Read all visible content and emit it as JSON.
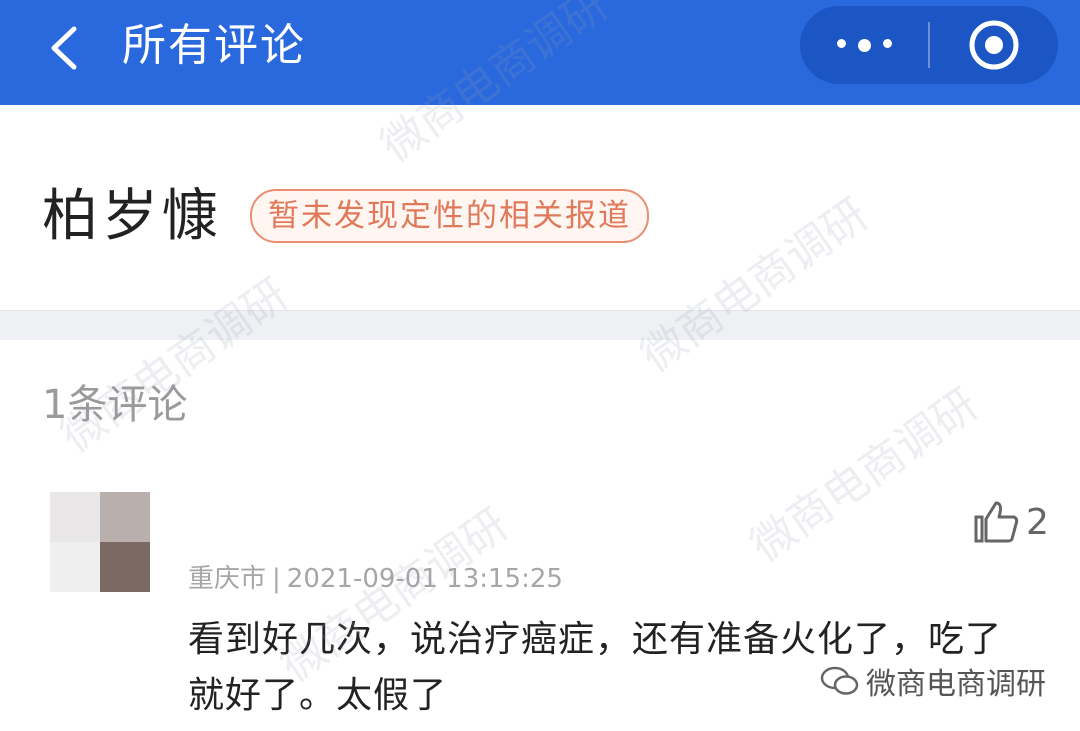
{
  "header": {
    "title": "所有评论",
    "back_icon": "chevron-left-icon",
    "more_icon": "more-dots-icon",
    "close_icon": "target-close-icon",
    "bg_color": "#2a68dd"
  },
  "entity": {
    "name": "柏岁慷",
    "badge": "暂未发现定性的相关报道",
    "badge_color": "#e0795a"
  },
  "comments": {
    "count_label": "1条评论",
    "items": [
      {
        "location": "重庆市",
        "separator": "|",
        "timestamp": "2021-09-01 13:15:25",
        "likes": "2",
        "text": "看到好几次，说治疗癌症，还有准备火化了，吃了就好了。太假了"
      }
    ]
  },
  "watermark": {
    "text": "微商电商调研",
    "badge_text": "微商电商调研"
  }
}
